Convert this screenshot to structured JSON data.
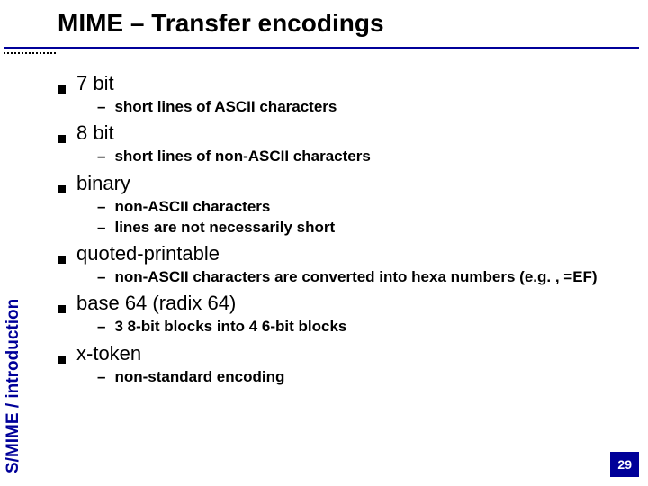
{
  "title": "MIME – Transfer encodings",
  "sidebar_label": "S/MIME / introduction",
  "page_number": "29",
  "bullets": {
    "b0": {
      "label": "7 bit",
      "subs": {
        "s0": "short lines of ASCII characters"
      }
    },
    "b1": {
      "label": "8 bit",
      "subs": {
        "s0": "short lines of non-ASCII characters"
      }
    },
    "b2": {
      "label": "binary",
      "subs": {
        "s0": "non-ASCII characters",
        "s1": "lines are not necessarily short"
      }
    },
    "b3": {
      "label": "quoted-printable",
      "subs": {
        "s0": "non-ASCII characters are converted into hexa numbers (e.g. , =EF)"
      }
    },
    "b4": {
      "label": "base 64 (radix 64)",
      "subs": {
        "s0": "3 8-bit blocks into 4 6-bit blocks"
      }
    },
    "b5": {
      "label": "x-token",
      "subs": {
        "s0": "non-standard encoding"
      }
    }
  }
}
